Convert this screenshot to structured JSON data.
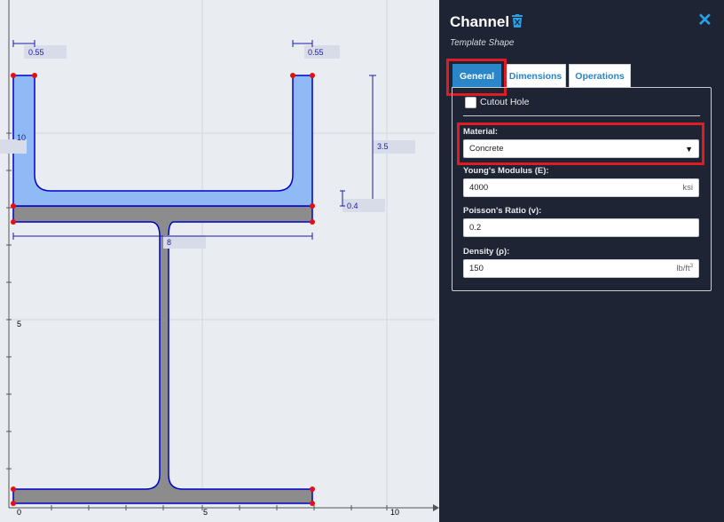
{
  "canvas": {
    "dimensions": {
      "top_left_width": "0.55",
      "top_right_width": "0.55",
      "channel_height": "3.5",
      "flange_thickness": "0.4",
      "section_width": "8",
      "left_height": "10"
    },
    "axis": {
      "y_labels": [
        "10",
        "5"
      ],
      "x_labels": [
        "0",
        "5",
        "10"
      ]
    }
  },
  "panel": {
    "title": "Channel",
    "subtitle": "Template Shape",
    "tabs": [
      {
        "label": "General",
        "active": true
      },
      {
        "label": "Dimensions",
        "active": false
      },
      {
        "label": "Operations",
        "active": false
      }
    ],
    "cutout_hole": {
      "label": "Cutout Hole",
      "checked": false
    },
    "material": {
      "label": "Material:",
      "value": "Concrete"
    },
    "youngs_modulus": {
      "label": "Young's Modulus (E):",
      "value": "4000",
      "unit": "ksi"
    },
    "poisson_ratio": {
      "label": "Poisson's Ratio (v):",
      "value": "0.2"
    },
    "density": {
      "label": "Density (ρ):",
      "value": "150",
      "unit": "lb/ft",
      "unit_sup": "3"
    }
  },
  "colors": {
    "panel_bg": "#1e2433",
    "accent": "#2a86c8",
    "highlight": "#e01b24",
    "channel_fill": "#8fbaf5",
    "ibeam_fill": "#8c8c8c"
  }
}
